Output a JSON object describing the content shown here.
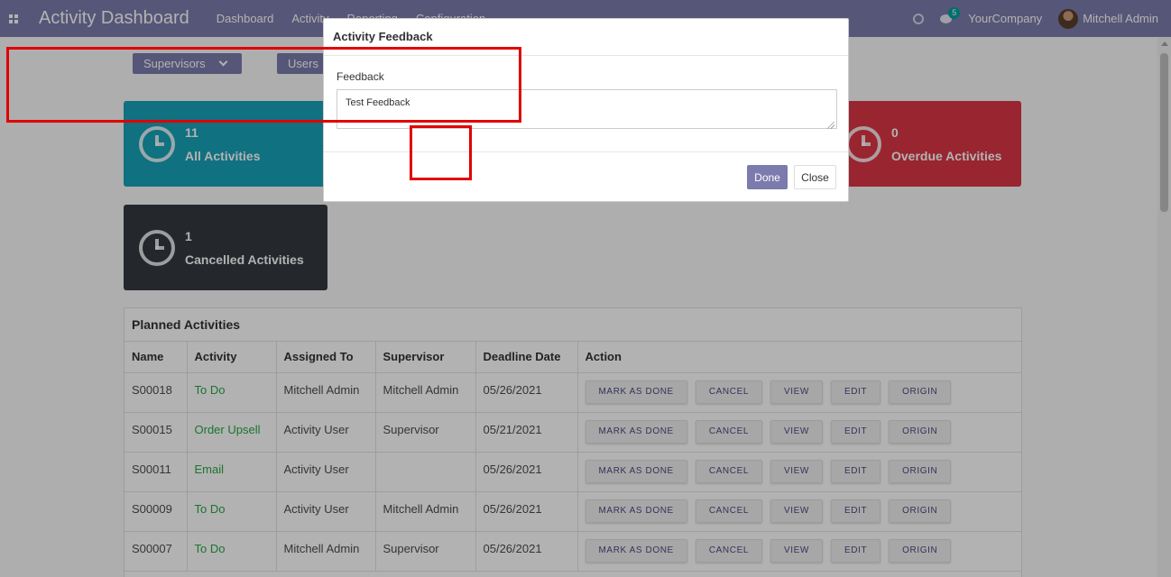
{
  "navbar": {
    "title": "Activity Dashboard",
    "menu": [
      "Dashboard",
      "Activity",
      "Reporting",
      "Configuration"
    ],
    "chat_count": "5",
    "company": "YourCompany",
    "user": "Mitchell Admin",
    "color": "#7c7bad"
  },
  "filters": {
    "supervisors": "Supervisors",
    "users": "Users"
  },
  "cards": {
    "all": {
      "count": "11",
      "label": "All Activities",
      "color": "#17a2b8"
    },
    "overdue": {
      "count": "0",
      "label": "Overdue Activities",
      "color": "#dc3545"
    },
    "cancelled": {
      "count": "1",
      "label": "Cancelled Activities",
      "color": "#343a40"
    }
  },
  "planned": {
    "title": "Planned Activities",
    "columns": [
      "Name",
      "Activity",
      "Assigned To",
      "Supervisor",
      "Deadline Date",
      "Action"
    ],
    "rows": [
      {
        "name": "S00018",
        "activity": "To Do",
        "assigned": "Mitchell Admin",
        "supervisor": "Mitchell Admin",
        "deadline": "05/26/2021"
      },
      {
        "name": "S00015",
        "activity": "Order Upsell",
        "assigned": "Activity User",
        "supervisor": "Supervisor",
        "deadline": "05/21/2021"
      },
      {
        "name": "S00011",
        "activity": "Email",
        "assigned": "Activity User",
        "supervisor": "",
        "deadline": "05/26/2021"
      },
      {
        "name": "S00009",
        "activity": "To Do",
        "assigned": "Activity User",
        "supervisor": "Mitchell Admin",
        "deadline": "05/26/2021"
      },
      {
        "name": "S00007",
        "activity": "To Do",
        "assigned": "Mitchell Admin",
        "supervisor": "Supervisor",
        "deadline": "05/26/2021"
      }
    ],
    "actions": [
      "MARK AS DONE",
      "CANCEL",
      "VIEW",
      "EDIT",
      "ORIGIN"
    ]
  },
  "modal": {
    "title": "Activity Feedback",
    "field_label": "Feedback",
    "field_value": "Test Feedback",
    "done_label": "Done",
    "close_label": "Close",
    "highlight_color": "#e00000"
  }
}
